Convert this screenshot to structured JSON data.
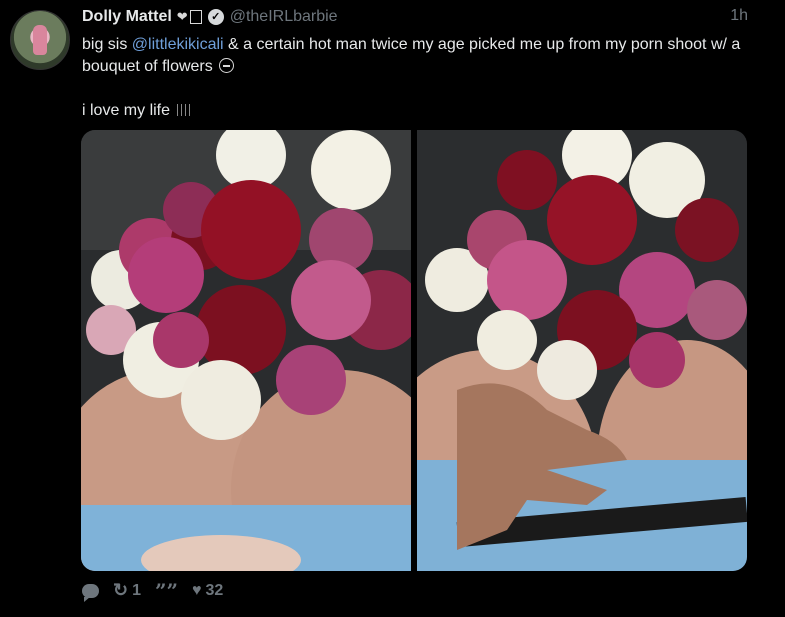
{
  "tweet": {
    "display_name": "Dolly Mattel",
    "heart_glyph": "❤",
    "handle": "@theIRLbarbie",
    "timestamp": "1h",
    "text_part1": "big sis ",
    "mention": "@littlekikicali",
    "text_part2": " & a certain hot man twice my age picked me up from my porn shoot w/ a bouquet of flowers ",
    "text_line2": "i love my life ",
    "verified": true
  },
  "actions": {
    "retweet_count": "1",
    "like_count": "32",
    "retweet_icon": "↻",
    "quote_icon": "””",
    "like_icon": "♥"
  },
  "icons": [
    "avatar",
    "heart-icon",
    "verified-icon",
    "reply-icon",
    "retweet-icon",
    "quote-icon",
    "like-icon"
  ],
  "colors": {
    "background": "#000000",
    "text": "#e7e9ea",
    "muted": "#6e767d",
    "link": "#6f9fd9"
  }
}
